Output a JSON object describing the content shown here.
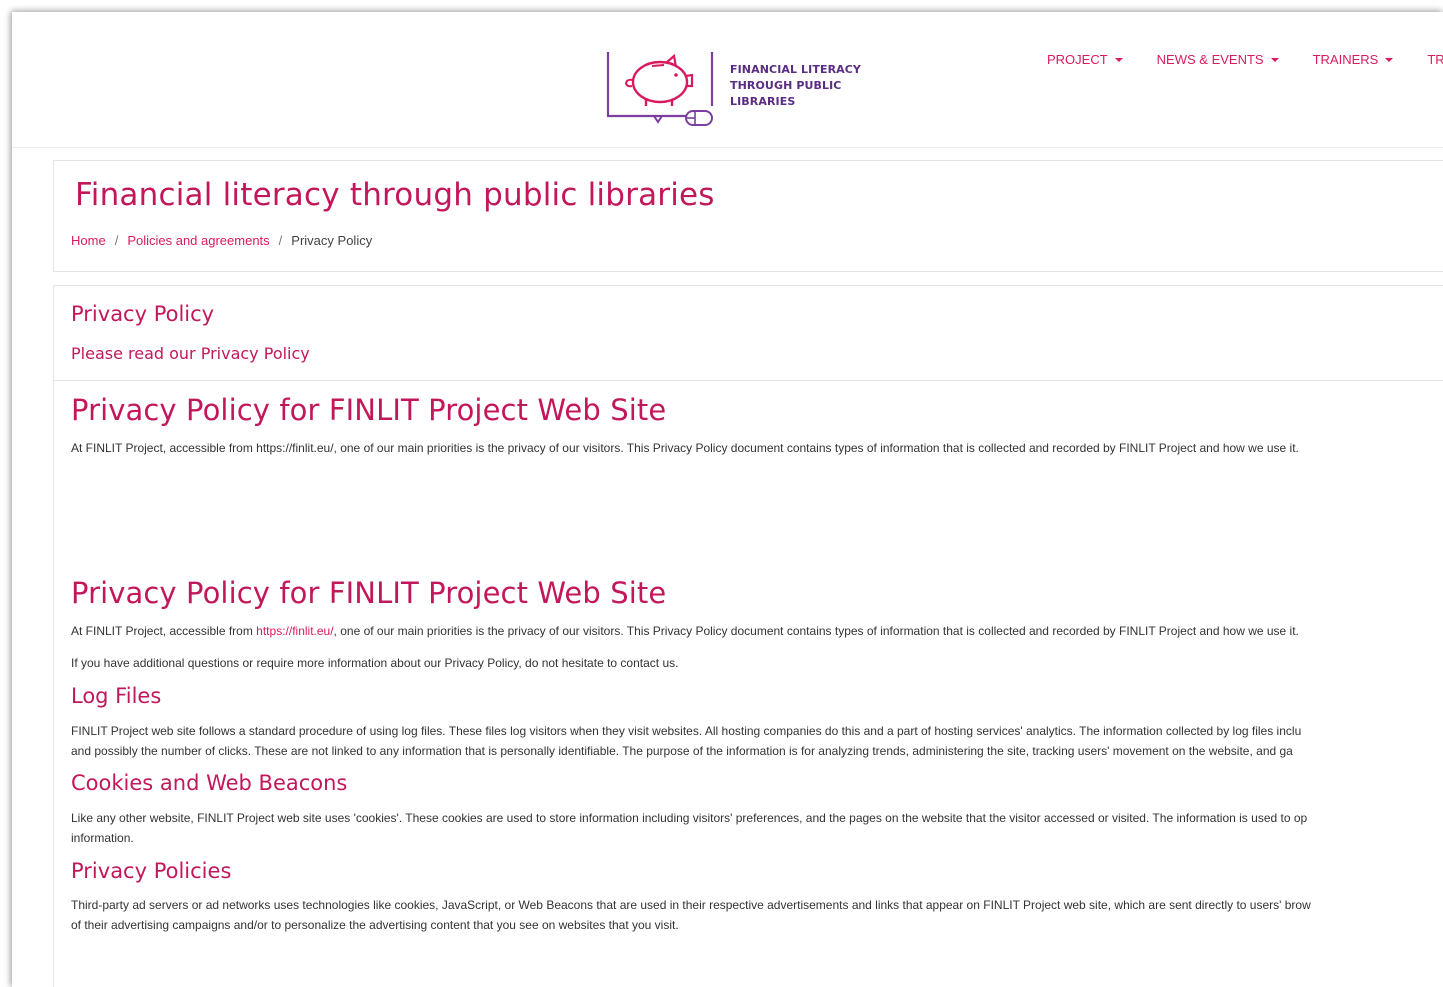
{
  "logo": {
    "text": "FINANCIAL LITERACY THROUGH PUBLIC LIBRARIES",
    "icon": "piggy-bank-screen-mouse-icon",
    "color": "#5a2d82"
  },
  "nav": {
    "items": [
      {
        "label": "PROJECT",
        "has_dropdown": true
      },
      {
        "label": "NEWS & EVENTS",
        "has_dropdown": true
      },
      {
        "label": "TRAINERS",
        "has_dropdown": true
      },
      {
        "label": "TRA",
        "has_dropdown": false
      }
    ]
  },
  "page": {
    "title": "Financial literacy through public libraries",
    "breadcrumb": {
      "home": "Home",
      "section": "Policies and agreements",
      "current": "Privacy Policy",
      "separator": "/"
    }
  },
  "content": {
    "heading": "Privacy Policy",
    "subtitle": "Please read our Privacy Policy",
    "section1": {
      "title": "Privacy Policy for FINLIT Project Web Site",
      "text": "At FINLIT Project, accessible from https://finlit.eu/, one of our main priorities is the privacy of our visitors. This Privacy Policy document contains types of information that is collected and recorded by FINLIT Project and how we use it."
    },
    "section2": {
      "title": "Privacy Policy for FINLIT Project Web Site",
      "text_before_link": "At FINLIT Project, accessible from ",
      "link": "https://finlit.eu/",
      "text_after_link": ", one of our main priorities is the privacy of our visitors. This Privacy Policy document contains types of information that is collected and recorded by FINLIT Project and how we use it.",
      "contact_text": "If you have additional questions or require more information about our Privacy Policy, do not hesitate to contact us."
    },
    "log_files": {
      "title": "Log Files",
      "line1": "FINLIT Project web site follows a standard procedure of using log files. These files log visitors when they visit websites. All hosting companies do this and a part of hosting services' analytics. The information collected by log files inclu",
      "line2": "and possibly the number of clicks. These are not linked to any information that is personally identifiable. The purpose of the information is for analyzing trends, administering the site, tracking users' movement on the website, and ga"
    },
    "cookies": {
      "title": "Cookies and Web Beacons",
      "line1": "Like any other website, FINLIT Project web site uses 'cookies'. These cookies are used to store information including visitors' preferences, and the pages on the website that the visitor accessed or visited. The information is used to op",
      "line2": "information."
    },
    "privacy_policies": {
      "title": "Privacy Policies",
      "line1": "Third-party ad servers or ad networks uses technologies like cookies, JavaScript, or Web Beacons that are used in their respective advertisements and links that appear on FINLIT Project web site, which are sent directly to users' brow",
      "line2": "of their advertising campaigns and/or to personalize the advertising content that you see on websites that you visit."
    }
  },
  "colors": {
    "accent": "#d81b60",
    "heading": "#c2185b",
    "logo": "#5a2d82",
    "text": "#333333"
  }
}
